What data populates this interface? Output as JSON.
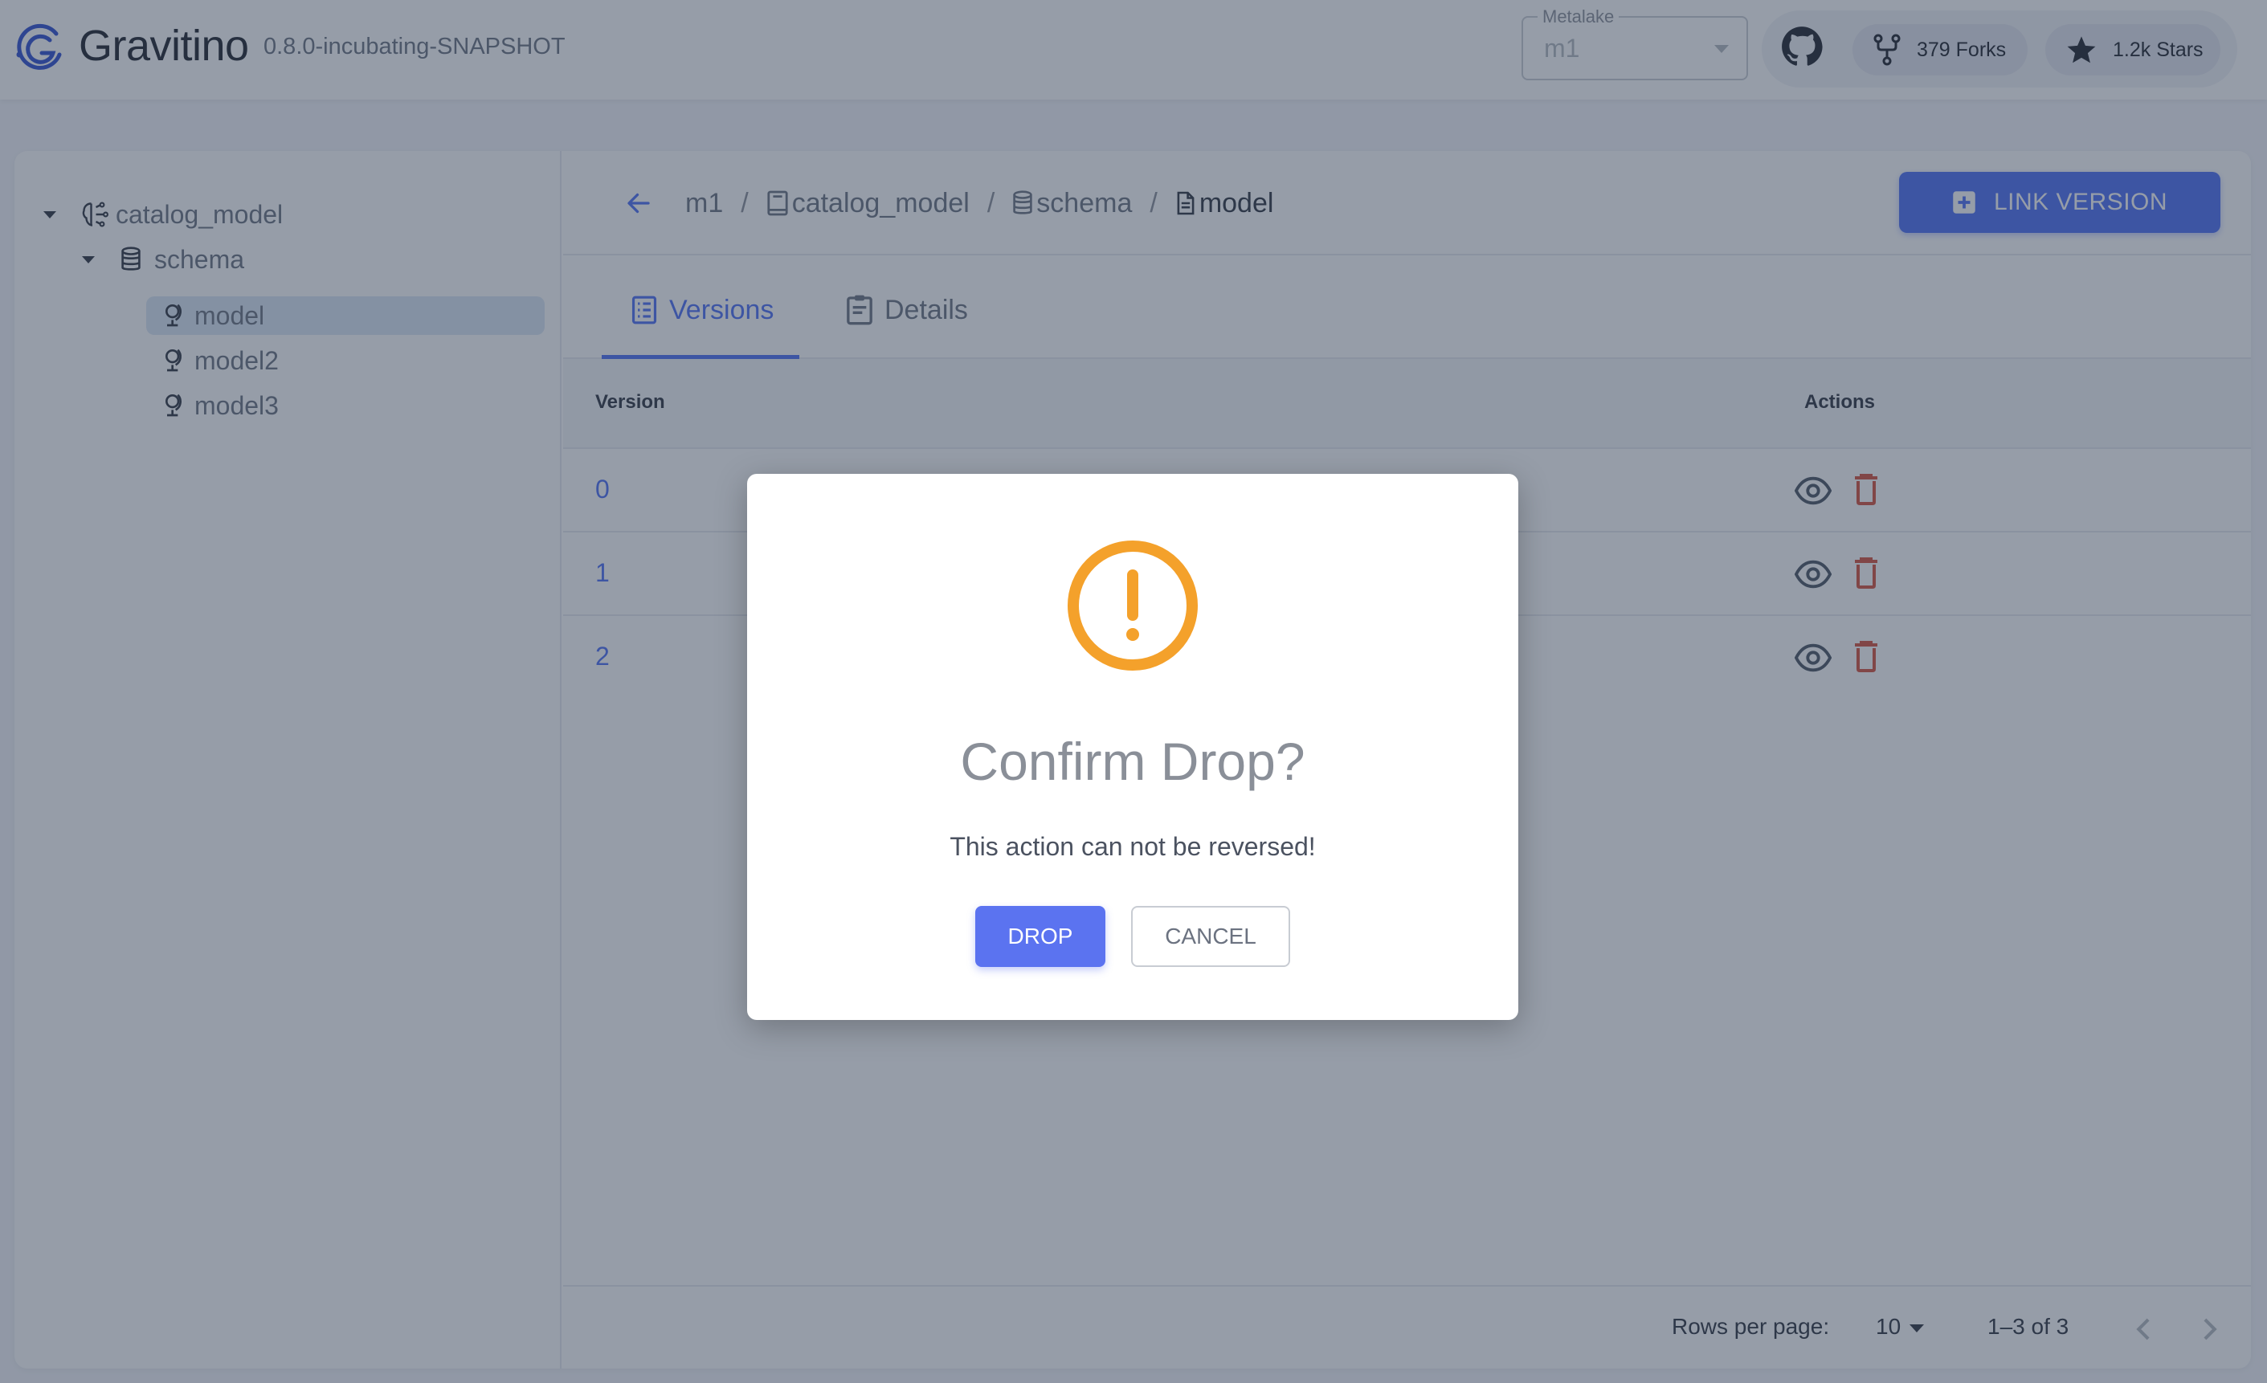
{
  "header": {
    "brand": "Gravitino",
    "version": "0.8.0-incubating-SNAPSHOT",
    "metalake": {
      "label": "Metalake",
      "value": "m1"
    },
    "github": {
      "forks": "379 Forks",
      "stars": "1.2k Stars"
    }
  },
  "sidebar": {
    "tree": [
      {
        "label": "catalog_model",
        "level": 0,
        "icon": "catalog-model-icon",
        "expanded": true
      },
      {
        "label": "schema",
        "level": 1,
        "icon": "database-icon",
        "expanded": true
      },
      {
        "label": "model",
        "level": 2,
        "icon": "model-icon",
        "selected": true
      },
      {
        "label": "model2",
        "level": 2,
        "icon": "model-icon"
      },
      {
        "label": "model3",
        "level": 2,
        "icon": "model-icon"
      }
    ]
  },
  "breadcrumb": {
    "items": [
      "m1",
      "catalog_model",
      "schema",
      "model"
    ],
    "separator": "/"
  },
  "toolbar": {
    "link_version_label": "LINK VERSION"
  },
  "tabs": [
    {
      "label": "Versions",
      "active": true
    },
    {
      "label": "Details",
      "active": false
    }
  ],
  "table": {
    "columns": [
      "Version",
      "Actions"
    ],
    "rows": [
      {
        "version": "0"
      },
      {
        "version": "1"
      },
      {
        "version": "2"
      }
    ]
  },
  "pagination": {
    "rows_per_page_label": "Rows per page:",
    "rows_per_page": "10",
    "range": "1–3 of 3"
  },
  "dialog": {
    "title": "Confirm Drop?",
    "message": "This action can not be reversed!",
    "confirm_label": "DROP",
    "cancel_label": "CANCEL"
  },
  "colors": {
    "accent": "#4c6ef5",
    "warning": "#f4a12b",
    "danger": "#d5503c"
  }
}
